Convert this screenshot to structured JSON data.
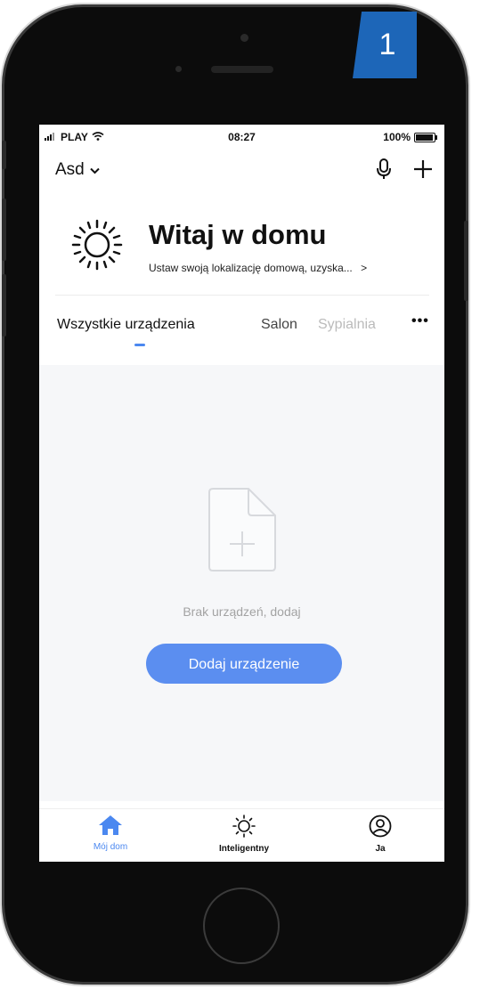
{
  "badge": {
    "number": "1"
  },
  "status_bar": {
    "carrier": "PLAY",
    "time": "08:27",
    "battery_percent": "100%",
    "battery_level": 1.0
  },
  "header": {
    "home_name": "Asd"
  },
  "welcome": {
    "title": "Witaj w domu",
    "subtitle": "Ustaw swoją lokalizację domową, uzyska...",
    "chevron": ">"
  },
  "tabs": {
    "items": [
      {
        "label": "Wszystkie urządzenia"
      },
      {
        "label": "Salon"
      },
      {
        "label": "Sypialnia"
      }
    ],
    "more": "•••"
  },
  "empty_state": {
    "message": "Brak urządzeń, dodaj",
    "button_label": "Dodaj urządzenie"
  },
  "bottom_tabs": {
    "home": "Mój dom",
    "smart": "Inteligentny",
    "me": "Ja"
  },
  "colors": {
    "accent": "#5b8ef0",
    "active_tab": "#4b88f0",
    "badge": "#1d66b8"
  }
}
